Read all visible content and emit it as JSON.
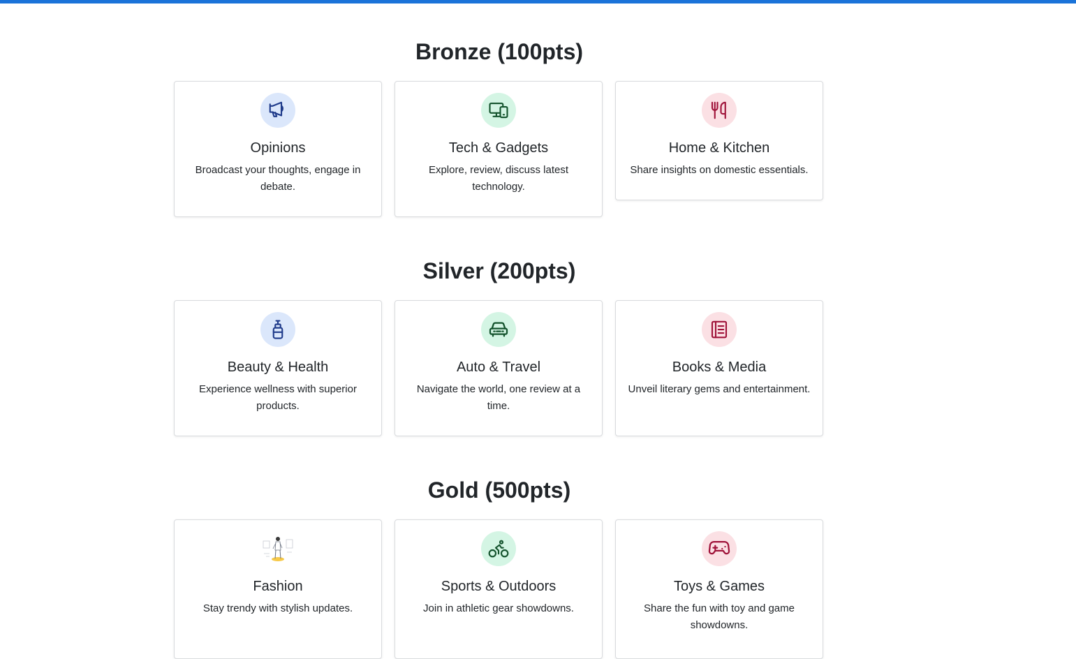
{
  "tiers": [
    {
      "title": "Bronze (100pts)",
      "cards": [
        {
          "title": "Opinions",
          "desc": "Broadcast your thoughts, engage in debate.",
          "icon": "megaphone-icon"
        },
        {
          "title": "Tech & Gadgets",
          "desc": "Explore, review, discuss latest technology.",
          "icon": "devices-icon"
        },
        {
          "title": "Home & Kitchen",
          "desc": "Share insights on domestic essentials.",
          "icon": "fork-knife-icon"
        }
      ]
    },
    {
      "title": "Silver (200pts)",
      "cards": [
        {
          "title": "Beauty & Health",
          "desc": "Experience wellness with superior products.",
          "icon": "lotion-bottle-icon"
        },
        {
          "title": "Auto & Travel",
          "desc": "Navigate the world, one review at a time.",
          "icon": "car-icon"
        },
        {
          "title": "Books & Media",
          "desc": "Unveil literary gems and entertainment.",
          "icon": "book-icon"
        }
      ]
    },
    {
      "title": "Gold (500pts)",
      "cards": [
        {
          "title": "Fashion",
          "desc": "Stay trendy with stylish updates.",
          "icon": "fashion-illustration-icon"
        },
        {
          "title": "Sports & Outdoors",
          "desc": "Join in athletic gear showdowns.",
          "icon": "bicycle-icon"
        },
        {
          "title": "Toys & Games",
          "desc": "Share the fun with toy and game showdowns.",
          "icon": "gamepad-icon"
        }
      ]
    }
  ],
  "colors": {
    "accent_bar": "#1a73d9",
    "icon_blue": "#1e3a8a",
    "icon_green": "#14532d",
    "icon_red": "#9f1239"
  }
}
